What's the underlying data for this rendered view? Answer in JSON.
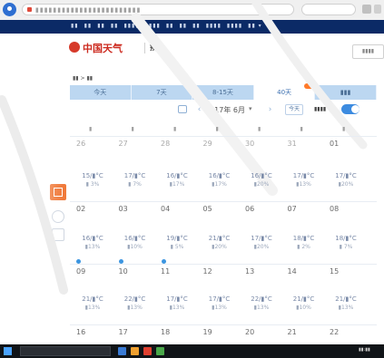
{
  "browser": {
    "address": "▮▮▮▮▮▮▮▮▮▮▮▮▮▮▮▮▮▮▮▮▮▮▮▮"
  },
  "nav": {
    "items": [
      "▮▮",
      "▮▮",
      "▮▮",
      "▮▮",
      "▮▮▮▮",
      "▮▮▮▮",
      "▮▮",
      "▮▮",
      "▮▮",
      "▮▮▮▮",
      "▮▮▮▮",
      "▮▮ ▾"
    ]
  },
  "logo": {
    "name": "中国天气",
    "sub": "预报"
  },
  "header": {
    "login": "▮▮▮▮"
  },
  "breadcrumb": "▮▮ > ▮▮",
  "tabs": [
    "今天",
    "7天",
    "8-15天",
    "40天",
    "▮▮▮"
  ],
  "active_tab": 3,
  "toolbar": {
    "prev": "‹",
    "next": "›",
    "year_month": "2017年 6月",
    "caret": "▾",
    "today": "今天",
    "toggle_label": "▮▮▮▮"
  },
  "calendar": {
    "weekdays": [
      "▮",
      "▮",
      "▮",
      "▮",
      "▮",
      "▮",
      "▮"
    ],
    "rows": [
      {
        "days": [
          "26",
          "27",
          "28",
          "29",
          "30",
          "31",
          "01"
        ],
        "weather": [
          {
            "t": "",
            "p": ""
          },
          {
            "t": "",
            "p": ""
          },
          {
            "t": "",
            "p": ""
          },
          {
            "t": "",
            "p": ""
          },
          {
            "t": "",
            "p": ""
          },
          {
            "t": "",
            "p": ""
          },
          {
            "t": "",
            "p": ""
          }
        ]
      },
      {
        "days": [
          "02",
          "03",
          "04",
          "05",
          "06",
          "07",
          "08"
        ],
        "weather": [
          {
            "t": "15/▮°C",
            "p": "▮ 3%"
          },
          {
            "t": "17/▮°C",
            "p": "▮ 7%"
          },
          {
            "t": "16/▮°C",
            "p": "▮17%"
          },
          {
            "t": "16/▮°C",
            "p": "▮17%"
          },
          {
            "t": "16/▮°C",
            "p": "▮20%"
          },
          {
            "t": "17/▮°C",
            "p": "▮13%"
          },
          {
            "t": "17/▮°C",
            "p": "▮20%"
          }
        ]
      },
      {
        "days": [
          "09",
          "10",
          "11",
          "12",
          "13",
          "14",
          "15"
        ],
        "weather": [
          {
            "t": "16/▮°C",
            "p": "▮13%"
          },
          {
            "t": "16/▮°C",
            "p": "▮10%"
          },
          {
            "t": "19/▮°C",
            "p": "▮ 5%"
          },
          {
            "t": "21/▮°C",
            "p": "▮20%"
          },
          {
            "t": "17/▮°C",
            "p": "▮20%"
          },
          {
            "t": "18/▮°C",
            "p": "▮ 2%"
          },
          {
            "t": "18/▮°C",
            "p": "▮ 7%"
          }
        ]
      },
      {
        "days": [
          "16",
          "17",
          "18",
          "19",
          "20",
          "21",
          "22"
        ],
        "weather": [
          {
            "t": "21/▮°C",
            "p": "▮13%"
          },
          {
            "t": "22/▮°C",
            "p": "▮13%"
          },
          {
            "t": "17/▮°C",
            "p": "▮13%"
          },
          {
            "t": "17/▮°C",
            "p": "▮13%"
          },
          {
            "t": "22/▮°C",
            "p": "▮13%"
          },
          {
            "t": "21/▮°C",
            "p": "▮10%"
          },
          {
            "t": "21/▮°C",
            "p": "▮13%"
          }
        ]
      }
    ]
  },
  "taskbar": {
    "search": "▮▮▮▮▮▮▮▮▮",
    "time": "▮▮:▮▮"
  },
  "colors": {
    "nav_bg": "#0b2a66",
    "tab_bg": "#bcd7f1",
    "brand_red": "#cc2a1f",
    "accent_blue": "#3c8be0",
    "accent_orange": "#f07a3a"
  }
}
